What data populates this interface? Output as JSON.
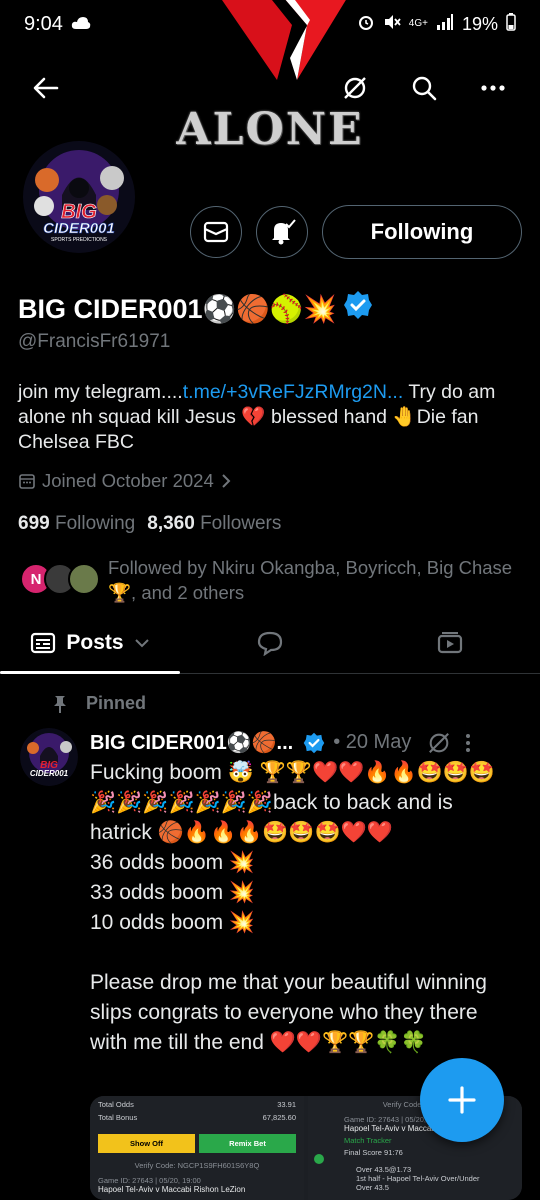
{
  "status": {
    "time": "9:04",
    "network": "4G+",
    "battery": "19%"
  },
  "banner": {
    "text": "ALONE"
  },
  "avatar": {
    "line1": "BIG",
    "line2": "CIDER001",
    "line3": "SPORTS PREDICTIONS"
  },
  "actions": {
    "following_label": "Following"
  },
  "profile": {
    "display_name": "BIG CIDER001⚽🏀🥎💥",
    "handle": "@FrancisFr61971",
    "bio_pre": "join my telegram....",
    "bio_link": "t.me/+3vReFJzRMrg2N...",
    "bio_post": " Try do am alone nh squad kill Jesus 💔 blessed hand 🤚Die fan Chelsea FBC",
    "joined": "Joined October 2024",
    "following_count": "699",
    "following_label": "Following",
    "followers_count": "8,360",
    "followers_label": "Followers",
    "followed_by": "Followed by Nkiru Okangba, Boyricch, Big Chase🏆, and 2 others",
    "mini_avatar_letter": "N"
  },
  "tabs": {
    "posts": "Posts"
  },
  "post": {
    "pinned_label": "Pinned",
    "author": "BIG CIDER001⚽🏀...",
    "date": "• 20 May",
    "line1": "Fucking boom 🤯 🏆🏆❤️❤️🔥🔥🤩🤩🤩",
    "line2": "🎉🎉🎉🎉🎉🎉🎉back to back and is",
    "line3": "hatrick 🏀🔥🔥🔥🤩🤩🤩❤️❤️",
    "line4": "36 odds boom 💥",
    "line5": "33 odds boom 💥",
    "line6": "10 odds boom 💥",
    "line7": "Please drop me that your beautiful winning slips congrats to everyone who they there with me till the end ❤️❤️🏆🏆🍀🍀"
  },
  "slip_left": {
    "total_odds_label": "Total Odds",
    "total_odds": "33.91",
    "total_bonus_label": "Total Bonus",
    "total_bonus": "67,825.60",
    "show_off": "Show Off",
    "remix": "Remix Bet",
    "verify": "Verify Code: NGCP1S9FH601S6Y8Q",
    "game": "Game ID: 27643 | 05/20, 19:00",
    "match": "Hapoel Tel-Aviv v Maccabi Rishon LeZion"
  },
  "slip_right": {
    "verify": "Verify Code: NGCP",
    "game": "Game ID: 27643 | 05/20, 19:",
    "match": "Hapoel Tel-Aviv v Maccabi",
    "tracker": "Match Tracker",
    "final_score_label": "Final Score",
    "final_score": "91:76",
    "pick": "Over 43.5@1.73",
    "market": "1st half - Hapoel Tel-Aviv Over/Under",
    "outcome": "Over 43.5"
  },
  "colors": {
    "accent": "#1d9bf0",
    "background": "#000000",
    "muted": "#71767b"
  }
}
